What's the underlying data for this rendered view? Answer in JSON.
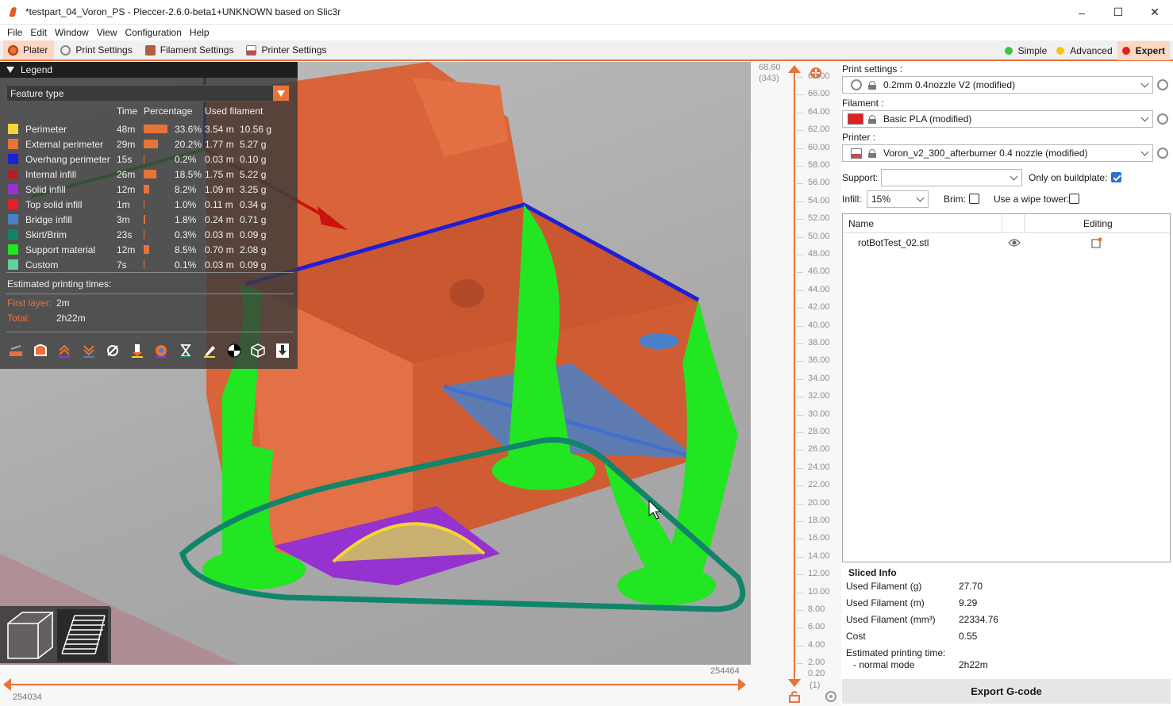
{
  "window": {
    "title": "*testpart_04_Voron_PS - Pleccer-2.6.0-beta1+UNKNOWN based on Slic3r",
    "controls": [
      "–",
      "☐",
      "✕"
    ]
  },
  "menu": [
    "File",
    "Edit",
    "Window",
    "View",
    "Configuration",
    "Help"
  ],
  "tabs": [
    {
      "label": "Plater",
      "active": true,
      "color": "#e8733a"
    },
    {
      "label": "Print Settings",
      "active": false,
      "color": "#888888"
    },
    {
      "label": "Filament Settings",
      "active": false,
      "color": "#b06040"
    },
    {
      "label": "Printer Settings",
      "active": false,
      "color": "#c0504d"
    }
  ],
  "modes": [
    {
      "label": "Simple",
      "color": "#3dc63d",
      "active": false
    },
    {
      "label": "Advanced",
      "color": "#f2c811",
      "active": false
    },
    {
      "label": "Expert",
      "color": "#e0201e",
      "active": true
    }
  ],
  "legend": {
    "header": "Legend",
    "view_type": "Feature type",
    "columns": {
      "time": "Time",
      "percentage": "Percentage",
      "used_filament": "Used filament"
    },
    "rows": [
      {
        "name": "Perimeter",
        "color": "#f2d535",
        "time": "48m",
        "percent": "33.6%",
        "fraction": 0.336,
        "length": "3.54 m",
        "weight": "10.56 g"
      },
      {
        "name": "External perimeter",
        "color": "#e8733a",
        "time": "29m",
        "percent": "20.2%",
        "fraction": 0.202,
        "length": "1.77 m",
        "weight": "5.27 g"
      },
      {
        "name": "Overhang perimeter",
        "color": "#1f1fd4",
        "time": "15s",
        "percent": "0.2%",
        "fraction": 0.002,
        "length": "0.03 m",
        "weight": "0.10 g"
      },
      {
        "name": "Internal infill",
        "color": "#b0202a",
        "time": "26m",
        "percent": "18.5%",
        "fraction": 0.185,
        "length": "1.75 m",
        "weight": "5.22 g"
      },
      {
        "name": "Solid infill",
        "color": "#9632d0",
        "time": "12m",
        "percent": "8.2%",
        "fraction": 0.082,
        "length": "1.09 m",
        "weight": "3.25 g"
      },
      {
        "name": "Top solid infill",
        "color": "#e81e2a",
        "time": "1m",
        "percent": "1.0%",
        "fraction": 0.01,
        "length": "0.11 m",
        "weight": "0.34 g"
      },
      {
        "name": "Bridge infill",
        "color": "#4a80c8",
        "time": "3m",
        "percent": "1.8%",
        "fraction": 0.018,
        "length": "0.24 m",
        "weight": "0.71 g"
      },
      {
        "name": "Skirt/Brim",
        "color": "#11856a",
        "time": "23s",
        "percent": "0.3%",
        "fraction": 0.003,
        "length": "0.03 m",
        "weight": "0.09 g"
      },
      {
        "name": "Support material",
        "color": "#22e622",
        "time": "12m",
        "percent": "8.5%",
        "fraction": 0.085,
        "length": "0.70 m",
        "weight": "2.08 g"
      },
      {
        "name": "Custom",
        "color": "#5ed39a",
        "time": "7s",
        "percent": "0.1%",
        "fraction": 0.001,
        "length": "0.03 m",
        "weight": "0.09 g"
      }
    ],
    "estimated_label": "Estimated printing times:",
    "first_layer_label": "First layer:",
    "first_layer_value": "2m",
    "total_label": "Total:",
    "total_value": "2h22m"
  },
  "horizontal_slider": {
    "low": "254034",
    "high": "254464"
  },
  "vertical_slider": {
    "top_value": "68.60",
    "top_layer": "(343)",
    "bottom_value": "0.20",
    "bottom_layer": "(1)",
    "ticks": [
      "68.00",
      "66.00",
      "64.00",
      "62.00",
      "60.00",
      "58.00",
      "56.00",
      "54.00",
      "52.00",
      "50.00",
      "48.00",
      "46.00",
      "44.00",
      "42.00",
      "40.00",
      "38.00",
      "36.00",
      "34.00",
      "32.00",
      "30.00",
      "28.00",
      "26.00",
      "24.00",
      "22.00",
      "20.00",
      "18.00",
      "16.00",
      "14.00",
      "12.00",
      "10.00",
      "8.00",
      "6.00",
      "4.00",
      "2.00"
    ]
  },
  "right_panel": {
    "print_settings_label": "Print settings :",
    "print_settings_value": "0.2mm 0.4nozzle V2 (modified)",
    "filament_label": "Filament :",
    "filament_value": "Basic PLA (modified)",
    "filament_color": "#e0201e",
    "printer_label": "Printer :",
    "printer_value": "Voron_v2_300_afterburner 0.4 nozzle (modified)",
    "support_label": "Support:",
    "support_value": "",
    "only_buildplate_label": "Only on buildplate:",
    "only_buildplate_checked": true,
    "infill_label": "Infill:",
    "infill_value": "15%",
    "brim_label": "Brim:",
    "brim_checked": false,
    "wipe_tower_label": "Use a wipe tower:",
    "wipe_tower_checked": false,
    "object_list": {
      "col_name": "Name",
      "col_editing": "Editing",
      "objects": [
        {
          "name": "rotBotTest_02.stl"
        }
      ]
    },
    "sliced_info": {
      "title": "Sliced Info",
      "rows": [
        {
          "label": "Used Filament (g)",
          "value": "27.70"
        },
        {
          "label": "Used Filament (m)",
          "value": "9.29"
        },
        {
          "label": "Used Filament (mm³)",
          "value": "22334.76"
        },
        {
          "label": "Cost",
          "value": "0.55"
        }
      ],
      "est_label": "Estimated printing time:",
      "mode_label": "- normal mode",
      "mode_value": "2h22m"
    },
    "export_label": "Export G-code"
  }
}
